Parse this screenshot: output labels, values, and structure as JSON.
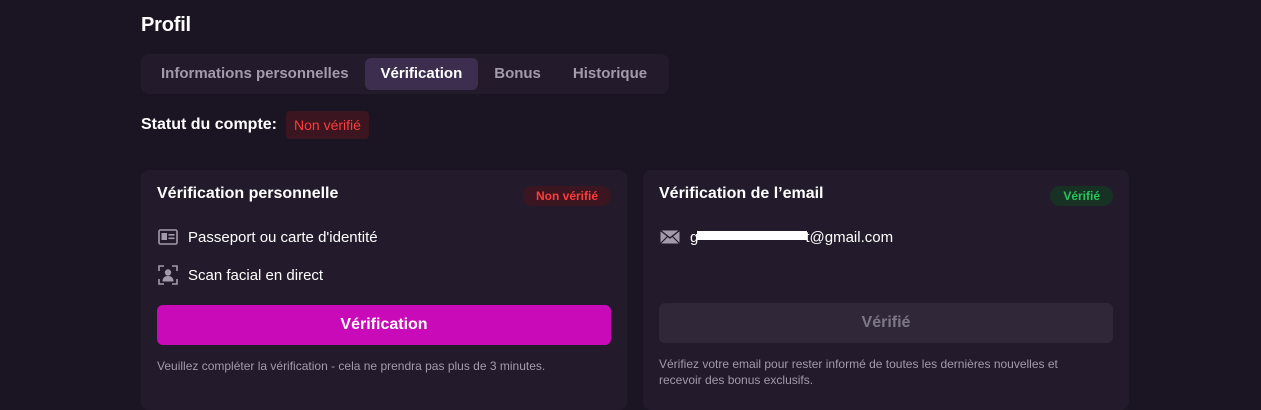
{
  "page": {
    "title": "Profil"
  },
  "tabs": [
    {
      "label": "Informations personnelles",
      "active": false
    },
    {
      "label": "Vérification",
      "active": true
    },
    {
      "label": "Bonus",
      "active": false
    },
    {
      "label": "Historique",
      "active": false
    }
  ],
  "account_status": {
    "label": "Statut du compte:",
    "value": "Non vérifié",
    "color": "#ff3b3b"
  },
  "personal_verification": {
    "title": "Vérification personnelle",
    "badge": "Non vérifié",
    "items": [
      {
        "icon": "id-card-icon",
        "label": "Passeport ou carte d'identité"
      },
      {
        "icon": "face-scan-icon",
        "label": "Scan facial en direct"
      }
    ],
    "button_label": "Vérification",
    "button_color": "#c80ab8",
    "helper_text": "Veuillez compléter la vérification - cela ne prendra pas plus de 3 minutes."
  },
  "email_verification": {
    "title": "Vérification de l’email",
    "badge": "Vérifié",
    "badge_color": "#29c459",
    "icon": "envelope-icon",
    "email_prefix": "g",
    "email_suffix": "t@gmail.com",
    "button_label": "Vérifié",
    "helper_line1": "Vérifiez votre email pour rester informé de toutes les dernières nouvelles et",
    "helper_line2": "recevoir des bonus exclusifs."
  }
}
